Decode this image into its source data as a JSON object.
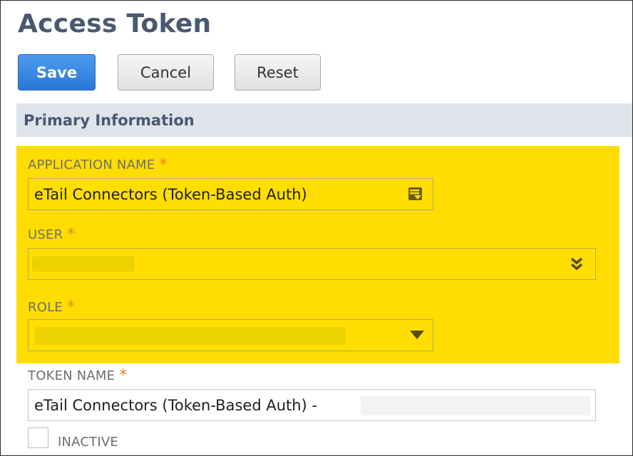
{
  "page": {
    "title": "Access Token"
  },
  "toolbar": {
    "save_label": "Save",
    "cancel_label": "Cancel",
    "reset_label": "Reset"
  },
  "section": {
    "title": "Primary Information"
  },
  "form": {
    "application_name": {
      "label": "APPLICATION NAME",
      "required": "*",
      "value": "eTail Connectors (Token-Based Auth)",
      "icon": "list-picker-icon"
    },
    "user": {
      "label": "USER",
      "required": "*",
      "value": "",
      "icon": "double-chevron-down-icon"
    },
    "role": {
      "label": "ROLE",
      "required": "*",
      "value": "",
      "icon": "dropdown-triangle-icon"
    },
    "token_name": {
      "label": "TOKEN NAME",
      "required": "*",
      "value": "eTail Connectors (Token-Based Auth) - "
    },
    "inactive": {
      "label": "INACTIVE",
      "checked": false
    }
  },
  "colors": {
    "highlight": "#ffdd00",
    "accent_blue": "#2a77d6",
    "heading": "#4a5870",
    "required_star": "#e08a2a"
  }
}
